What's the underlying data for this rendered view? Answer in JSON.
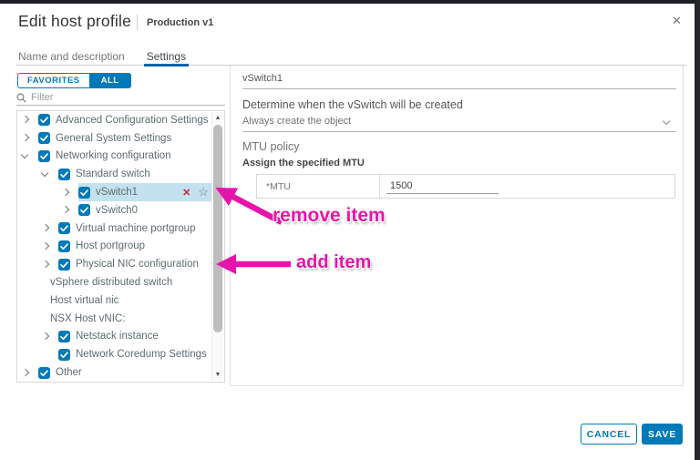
{
  "header": {
    "title": "Edit host profile",
    "subtitle": "Production v1"
  },
  "tabs": [
    {
      "label": "Name and description",
      "active": false
    },
    {
      "label": "Settings",
      "active": true
    }
  ],
  "left_panel": {
    "favorites_button": "FAVORITES",
    "all_button": "ALL",
    "filter_placeholder": "Filter",
    "tree": [
      {
        "label": "Advanced Configuration Settings",
        "level": 0,
        "chevron": "right",
        "checkbox": true
      },
      {
        "label": "General System Settings",
        "level": 0,
        "chevron": "right",
        "checkbox": true
      },
      {
        "label": "Networking configuration",
        "level": 0,
        "chevron": "down",
        "checkbox": true
      },
      {
        "label": "Standard switch",
        "level": 1,
        "chevron": "down",
        "checkbox": true
      },
      {
        "label": "vSwitch1",
        "level": 2,
        "chevron": "right",
        "checkbox": true,
        "selected": true,
        "actions": "remove"
      },
      {
        "label": "vSwitch0",
        "level": 2,
        "chevron": "right",
        "checkbox": true
      },
      {
        "label": "Virtual machine portgroup",
        "level": 1,
        "chevron": "right",
        "checkbox": true
      },
      {
        "label": "Host portgroup",
        "level": 1,
        "chevron": "right",
        "checkbox": true
      },
      {
        "label": "Physical NIC configuration",
        "level": 1,
        "chevron": "right",
        "checkbox": true,
        "actions": "add"
      },
      {
        "label": "vSphere distributed switch",
        "level": "plain"
      },
      {
        "label": "Host virtual nic",
        "level": "plain"
      },
      {
        "label": "NSX Host vNIC:",
        "level": "plain"
      },
      {
        "label": "Netstack instance",
        "level": 1,
        "chevron": "right",
        "checkbox": true
      },
      {
        "label": "Network Coredump Settings",
        "level": 1,
        "chevron": "none",
        "checkbox": true
      },
      {
        "label": "Other",
        "level": 0,
        "chevron": "right",
        "checkbox": true
      }
    ]
  },
  "right_panel": {
    "name_value": "vSwitch1",
    "create_label": "Determine when the vSwitch will be created",
    "create_value": "Always create the object",
    "mtu_section": "MTU policy",
    "mtu_subsection": "Assign the specified MTU",
    "mtu_field_label": "*MTU",
    "mtu_value": "1500"
  },
  "annotations": {
    "remove_label": "remove item",
    "add_label": "add item",
    "color": "#e515ab"
  },
  "footer": {
    "cancel": "CANCEL",
    "save": "SAVE"
  },
  "icons": {
    "close": "✕",
    "remove": "✕",
    "star": "☆",
    "add": "+",
    "scroll_up": "▲",
    "scroll_down": "▼"
  },
  "colors": {
    "primary": "#0079b8",
    "tab_underline": "#0065ab",
    "selection": "#c3e1ef",
    "remove_x": "#c92134",
    "annotation": "#e515ab"
  }
}
